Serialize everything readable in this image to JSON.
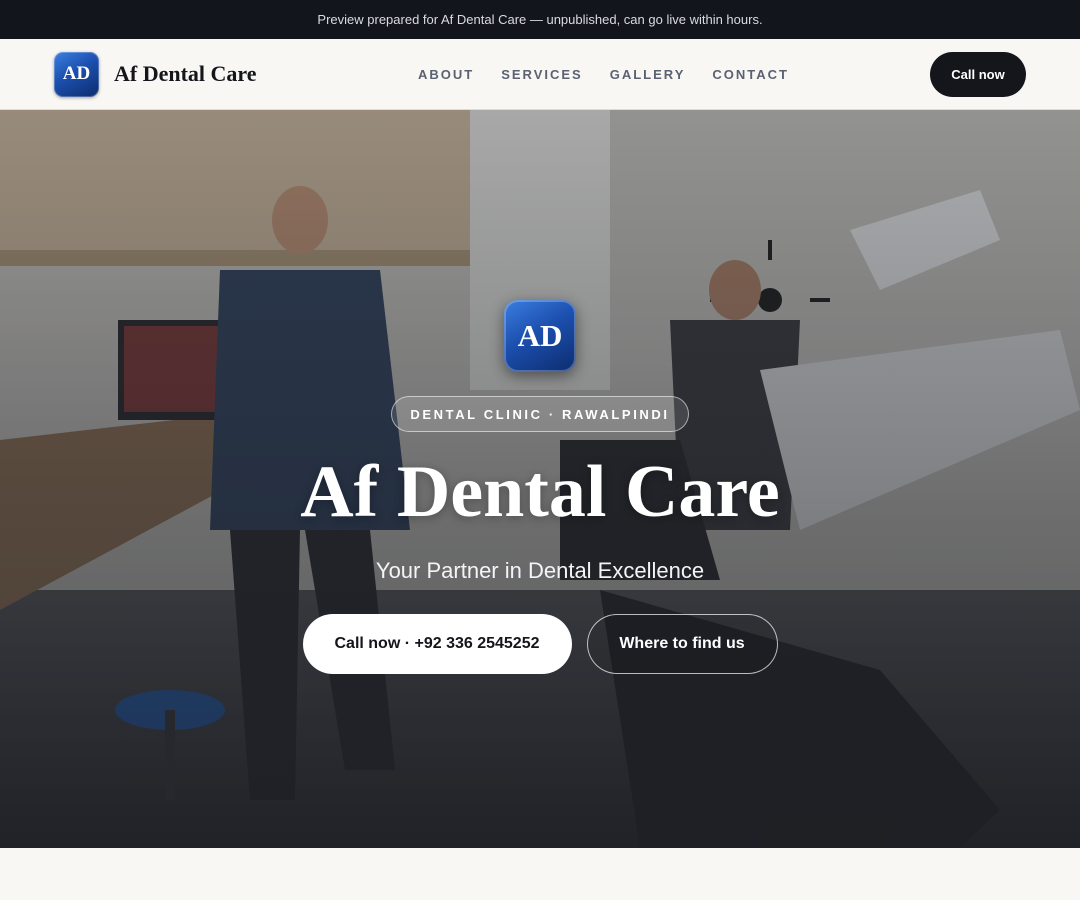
{
  "banner": {
    "text": "Preview prepared for Af Dental Care — unpublished, can go live within hours."
  },
  "header": {
    "logo_text": "AD",
    "brand_name": "Af Dental Care",
    "nav": [
      {
        "label": "ABOUT"
      },
      {
        "label": "SERVICES"
      },
      {
        "label": "GALLERY"
      },
      {
        "label": "CONTACT"
      }
    ],
    "cta_label": "Call now"
  },
  "hero": {
    "logo_text": "AD",
    "eyebrow": "DENTAL CLINIC · RAWALPINDI",
    "title": "Af Dental Care",
    "subtitle": "Your Partner in Dental Excellence",
    "primary_button": "Call now · +92 336 2545252",
    "secondary_button": "Where to find us",
    "background_image": "dental clinic photo with dentist, assistant and dental chair"
  },
  "colors": {
    "dark": "#12151b",
    "brand_blue": "#1c4fae",
    "page_bg": "#f8f7f4",
    "nav_text": "#5a6170"
  }
}
